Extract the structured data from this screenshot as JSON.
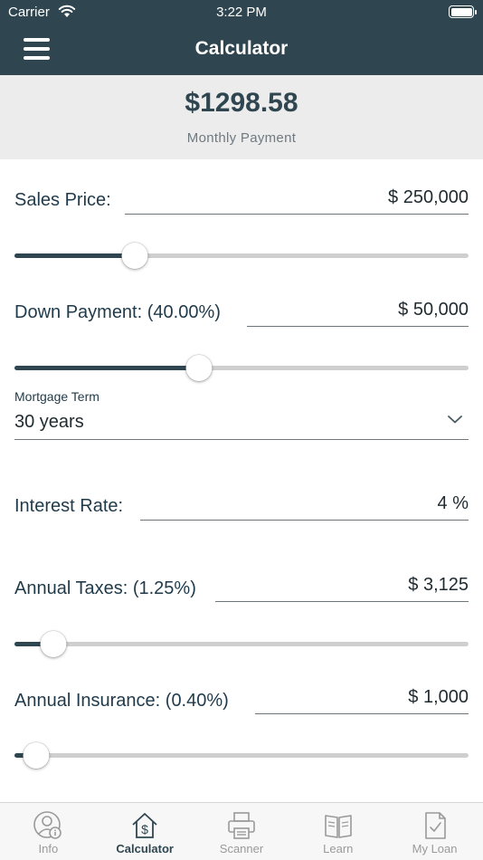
{
  "status": {
    "carrier": "Carrier",
    "time": "3:22 PM"
  },
  "nav": {
    "title": "Calculator"
  },
  "summary": {
    "amount": "$1298.58",
    "label": "Monthly Payment"
  },
  "fields": {
    "sales_price": {
      "label": "Sales Price:",
      "value": "$ 250,000",
      "slider_fraction": 0.25
    },
    "down_payment": {
      "label": "Down Payment: (40.00%)",
      "value": "$ 50,000",
      "slider_fraction": 0.4
    },
    "mortgage_term": {
      "label": "Mortgage Term",
      "value": "30 years"
    },
    "interest_rate": {
      "label": "Interest Rate:",
      "value": "4 %"
    },
    "annual_taxes": {
      "label": "Annual Taxes: (1.25%)",
      "value": "$ 3,125",
      "slider_fraction": 0.06
    },
    "annual_insurance": {
      "label": "Annual Insurance: (0.40%)",
      "value": "$ 1,000",
      "slider_fraction": 0.02
    }
  },
  "tabs": [
    {
      "label": "Info",
      "icon": "info-person-icon",
      "active": false
    },
    {
      "label": "Calculator",
      "icon": "house-dollar-icon",
      "active": true
    },
    {
      "label": "Scanner",
      "icon": "scanner-icon",
      "active": false
    },
    {
      "label": "Learn",
      "icon": "book-icon",
      "active": false
    },
    {
      "label": "My Loan",
      "icon": "document-check-icon",
      "active": false
    }
  ],
  "colors": {
    "primary": "#2f4650",
    "summary_bg": "#ececec",
    "track": "#cfcfcf",
    "tab_inactive": "#9a9a9a"
  }
}
